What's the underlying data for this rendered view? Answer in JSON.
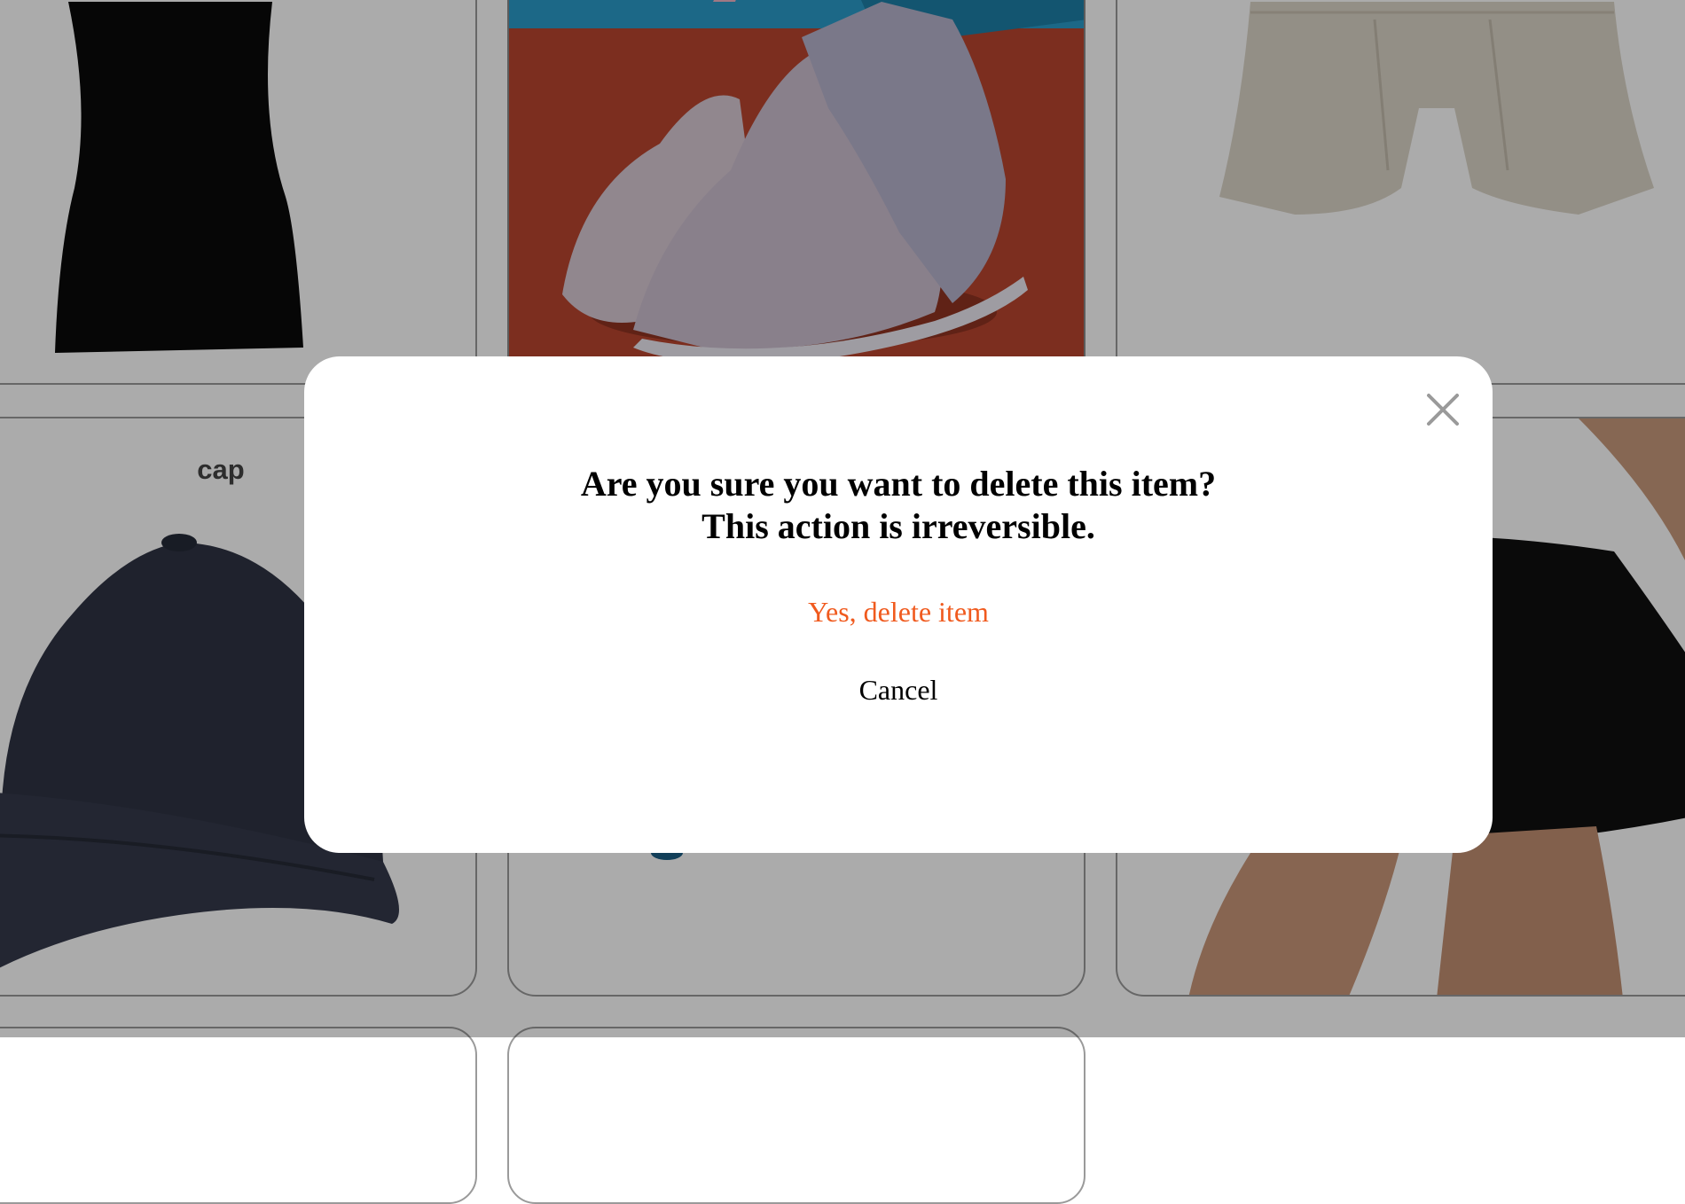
{
  "products": [
    {
      "name": ""
    },
    {
      "name": ""
    },
    {
      "name": ""
    },
    {
      "name": "cap"
    },
    {
      "name": ""
    },
    {
      "name": ""
    }
  ],
  "modal": {
    "message_line1": "Are you sure you want to delete this item?",
    "message_line2": "This action is irreversible.",
    "confirm_label": "Yes, delete item",
    "cancel_label": "Cancel",
    "close_icon": "close-icon"
  },
  "colors": {
    "confirm": "#f05a1e",
    "overlay": "rgba(0,0,0,0.33)"
  }
}
